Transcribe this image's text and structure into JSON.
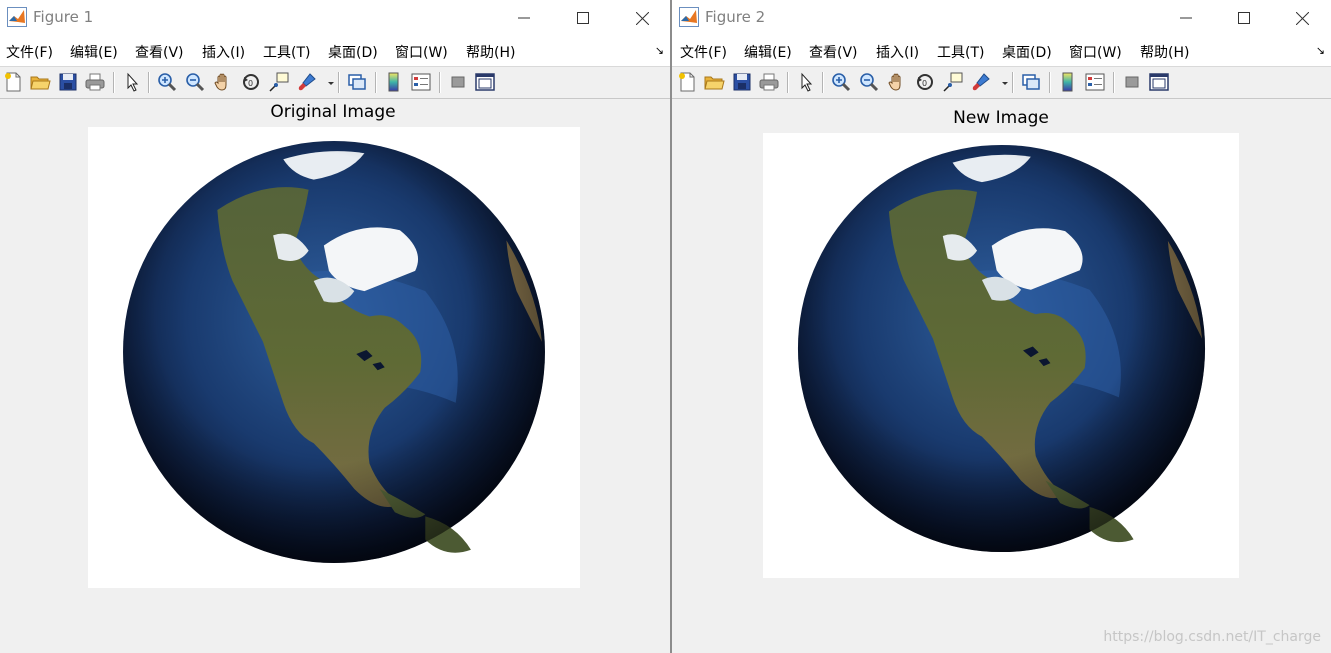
{
  "windows": [
    {
      "title": "Figure 1",
      "menu": [
        "文件(F)",
        "编辑(E)",
        "查看(V)",
        "插入(I)",
        "工具(T)",
        "桌面(D)",
        "窗口(W)",
        "帮助(H)"
      ],
      "figure_title": "Original Image"
    },
    {
      "title": "Figure 2",
      "menu": [
        "文件(F)",
        "编辑(E)",
        "查看(V)",
        "插入(I)",
        "工具(T)",
        "桌面(D)",
        "窗口(W)",
        "帮助(H)"
      ],
      "figure_title": "New Image"
    }
  ],
  "toolbar_icons": [
    "new-figure-icon",
    "open-file-icon",
    "save-icon",
    "print-icon",
    "edit-plot-cursor-icon",
    "zoom-in-icon",
    "zoom-out-icon",
    "pan-hand-icon",
    "rotate-3d-icon",
    "data-cursor-icon",
    "brush-icon",
    "link-plot-icon",
    "colorbar-icon",
    "legend-icon",
    "hide-plot-tools-icon",
    "show-plot-tools-icon"
  ],
  "dock_arrow": "↘",
  "watermark": "https://blog.csdn.net/IT_charge",
  "colors": {
    "ocean_deep": "#0d1a36",
    "ocean_shelf": "#2b5a9a",
    "land": "#4f5e2a",
    "ice": "#ffffff",
    "window_bg": "#f0f0f0"
  }
}
